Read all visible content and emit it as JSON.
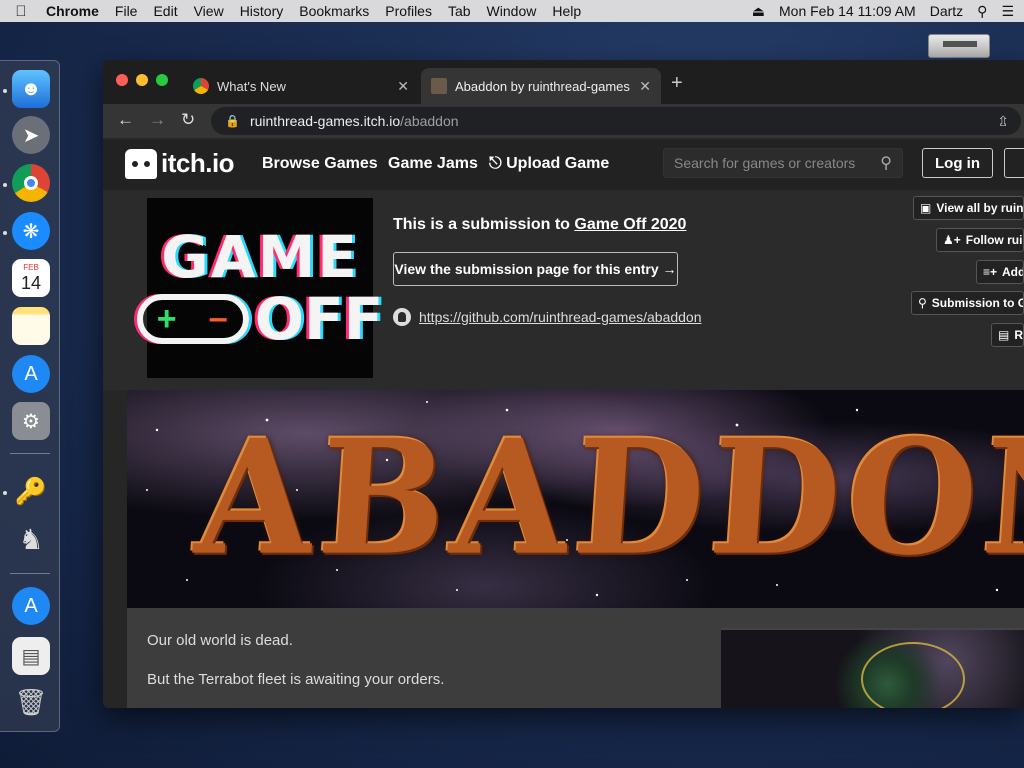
{
  "menubar": {
    "app": "Chrome",
    "items": [
      "File",
      "Edit",
      "View",
      "History",
      "Bookmarks",
      "Profiles",
      "Tab",
      "Window",
      "Help"
    ],
    "datetime": "Mon Feb 14  11:09 AM",
    "user": "Dartz"
  },
  "dock": {
    "calendar_month": "FEB",
    "calendar_day": "14"
  },
  "browser": {
    "tabs": [
      {
        "label": "What's New"
      },
      {
        "label": "Abaddon by ruinthread-games"
      }
    ],
    "url_domain": "ruinthread-games.itch.io",
    "url_path": "/abaddon"
  },
  "itch": {
    "logo": "itch.io",
    "nav": [
      "Browse Games",
      "Game Jams",
      "Upload Game"
    ],
    "search_placeholder": "Search for games or creators",
    "login_label": "Log in"
  },
  "jam": {
    "logo_line1": "GAME",
    "logo_line2": "OFF",
    "submission_prefix": "This is a submission to ",
    "jam_name": "Game Off 2020",
    "view_submission_label": "View the submission page for this entry →",
    "github_url": "https://github.com/ruinthread-games/abaddon"
  },
  "side_buttons": [
    "View all by ruint",
    "Follow ruint",
    "Add",
    "Submission to G",
    "R"
  ],
  "game": {
    "banner_title": "ABADDON",
    "desc_line1": "Our old world is dead.",
    "desc_line2": "But the Terrabot fleet is awaiting your orders."
  },
  "colors": {
    "menubar_bg": "#d9d9db",
    "itch_header_bg": "#222222",
    "banner_title": "#b65a22"
  }
}
